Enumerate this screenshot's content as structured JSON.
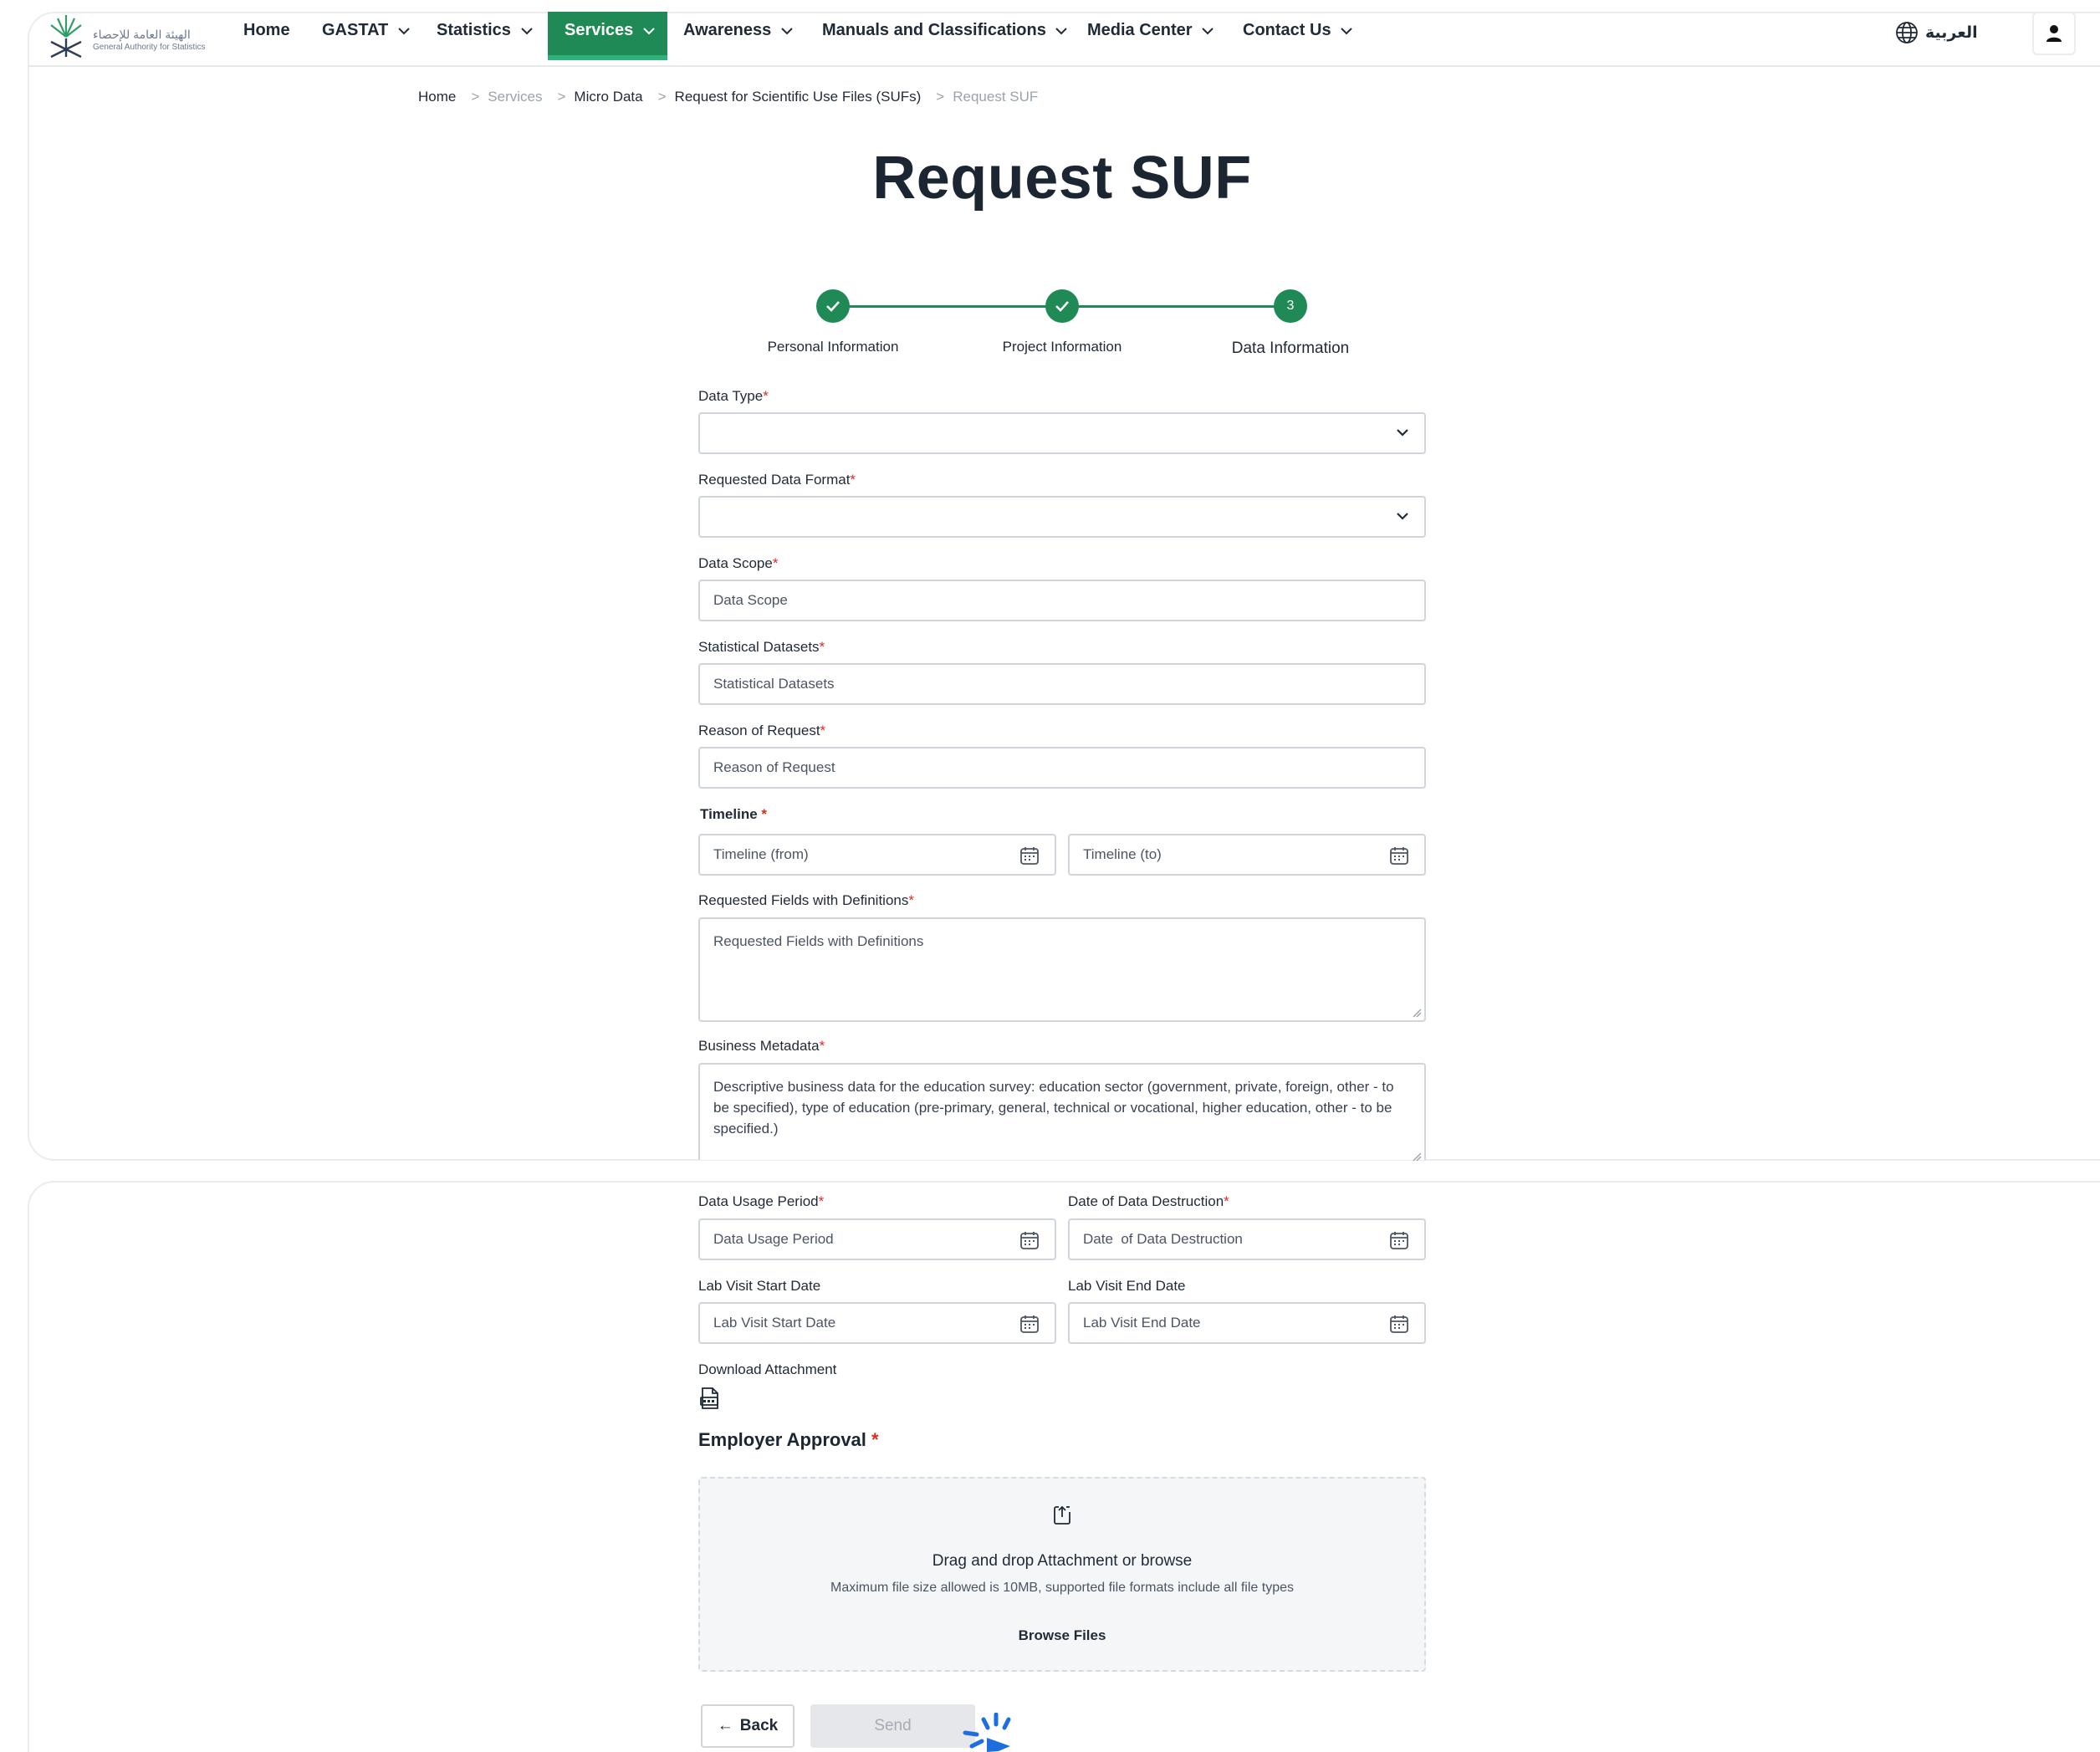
{
  "nav": {
    "items": [
      {
        "label": "Home",
        "has_menu": false
      },
      {
        "label": "GASTAT",
        "has_menu": true
      },
      {
        "label": "Statistics",
        "has_menu": true
      },
      {
        "label": "Services",
        "has_menu": true,
        "active": true
      },
      {
        "label": "Awareness",
        "has_menu": true
      },
      {
        "label": "Manuals and Classifications",
        "has_menu": true
      },
      {
        "label": "Media Center",
        "has_menu": true
      },
      {
        "label": "Contact Us",
        "has_menu": true
      }
    ],
    "language_label": "العربية",
    "logo_text_ar": "الهيئة العامة للإحصاء",
    "logo_text_en": "General Authority for Statistics"
  },
  "breadcrumb": [
    "Home",
    "Services",
    "Micro Data",
    "Request for Scientific Use Files (SUFs)",
    "Request SUF"
  ],
  "page_title": "Request SUF",
  "stepper": {
    "steps": [
      {
        "label": "Personal Information",
        "status": "done"
      },
      {
        "label": "Project Information",
        "status": "done"
      },
      {
        "label": "Data Information",
        "status": "current",
        "number": "3"
      }
    ]
  },
  "form": {
    "data_type": {
      "label": "Data Type",
      "value": ""
    },
    "data_format": {
      "label": "Requested Data Format",
      "value": ""
    },
    "data_scope": {
      "label": "Data Scope",
      "placeholder": "Data Scope"
    },
    "datasets": {
      "label": "Statistical Datasets",
      "placeholder": "Statistical Datasets"
    },
    "reason": {
      "label": "Reason of Request",
      "placeholder": "Reason of Request"
    },
    "timeline": {
      "label": "Timeline",
      "from_placeholder": "Timeline (from)",
      "to_placeholder": "Timeline (to)"
    },
    "fields_defs": {
      "label": "Requested Fields with Definitions",
      "placeholder": "Requested Fields with Definitions"
    },
    "business_metadata": {
      "label": "Business Metadata",
      "value": "Descriptive business data for the education survey: education sector (government, private, foreign, other - to be specified), type of education (pre-primary, general, technical or vocational, higher education, other - to be specified.)"
    },
    "usage_period": {
      "label": "Data Usage Period",
      "placeholder": "Data Usage Period"
    },
    "destruction_date": {
      "label": "Date of Data Destruction",
      "placeholder": "Date  of Data Destruction"
    },
    "lab_start": {
      "label": "Lab Visit Start Date",
      "placeholder": "Lab Visit Start Date"
    },
    "lab_end": {
      "label": "Lab Visit End Date",
      "placeholder": "Lab Visit End Date"
    },
    "download_attachment": {
      "label": "Download Attachment"
    },
    "employer_approval": {
      "title": "Employer Approval",
      "dropzone_title": "Drag and drop Attachment or browse",
      "dropzone_subtitle": "Maximum file size allowed is 10MB, supported file formats include all file types",
      "browse_label": "Browse Files"
    },
    "required_mark": "*"
  },
  "actions": {
    "back_label": "Back",
    "send_label": "Send",
    "back_arrow": "←"
  },
  "colors": {
    "brand_green": "#1f8a55",
    "required_red": "#d92d20"
  }
}
